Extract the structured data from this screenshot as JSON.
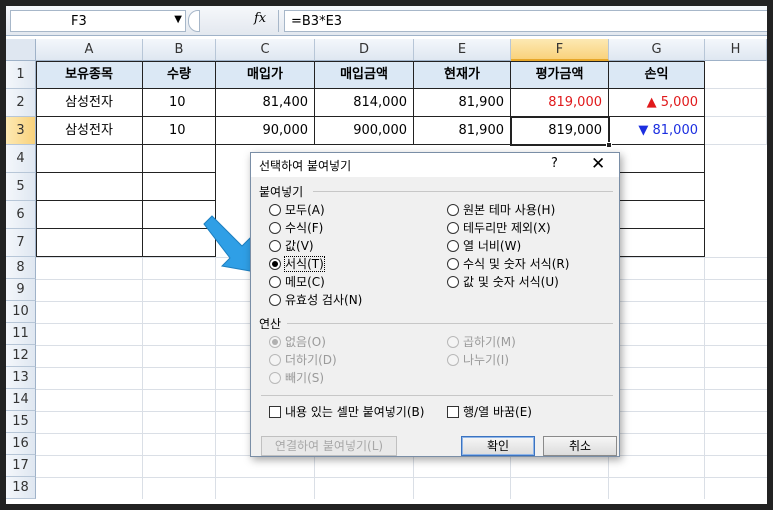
{
  "formula_bar": {
    "name_box": "F3",
    "fx_label": "fx",
    "formula": "=B3*E3"
  },
  "columns": [
    "A",
    "B",
    "C",
    "D",
    "E",
    "F",
    "G",
    "H"
  ],
  "rows": [
    "1",
    "2",
    "3",
    "4",
    "5",
    "6",
    "7",
    "8",
    "9",
    "10",
    "11",
    "12",
    "13",
    "14",
    "15",
    "16",
    "17",
    "18"
  ],
  "sheet": {
    "headers": [
      "보유종목",
      "수량",
      "매입가",
      "매입금액",
      "현재가",
      "평가금액",
      "손익"
    ],
    "row2": [
      "삼성전자",
      "10",
      "81,400",
      "814,000",
      "81,900",
      "819,000",
      "▲ 5,000"
    ],
    "row3": [
      "삼성전자",
      "10",
      "90,000",
      "900,000",
      "81,900",
      "819,000",
      "▼ 81,000"
    ]
  },
  "dialog": {
    "title": "선택하여 붙여넣기",
    "help": "?",
    "close": "✕",
    "paste_group": "붙여넣기",
    "paste_left": [
      "모두(A)",
      "수식(F)",
      "값(V)",
      "서식(T)",
      "메모(C)",
      "유효성 검사(N)"
    ],
    "paste_right": [
      "원본 테마 사용(H)",
      "테두리만 제외(X)",
      "열 너비(W)",
      "수식 및 숫자 서식(R)",
      "값 및 숫자 서식(U)"
    ],
    "selected_option": "서식(T)",
    "op_group": "연산",
    "op_left": [
      "없음(O)",
      "더하기(D)",
      "빼기(S)"
    ],
    "op_right": [
      "곱하기(M)",
      "나누기(I)"
    ],
    "skip_blanks": "내용 있는 셀만 붙여넣기(B)",
    "transpose": "행/열 바꿈(E)",
    "paste_link": "연결하여 붙여넣기(L)",
    "ok": "확인",
    "cancel": "취소"
  },
  "colors": {
    "accent_arrow": "#2f9fe6",
    "loss_red": "#e0191b",
    "gain_blue": "#1c2fe0",
    "header_fill": "#dbe8f5"
  }
}
